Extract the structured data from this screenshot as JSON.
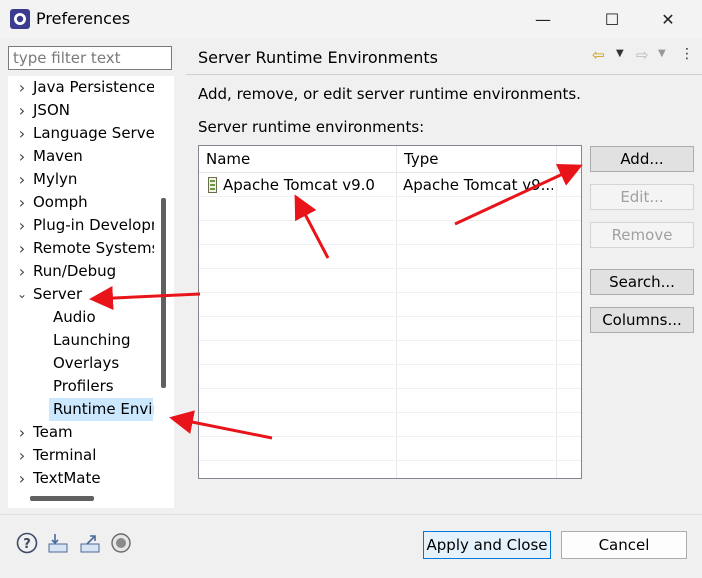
{
  "window": {
    "title": "Preferences",
    "minimize_glyph": "—",
    "maximize_glyph": "☐",
    "close_glyph": "✕"
  },
  "filter": {
    "placeholder": "type filter text",
    "value": ""
  },
  "tree": {
    "items": [
      {
        "label": "Java Persistence",
        "expandable": true
      },
      {
        "label": "JSON",
        "expandable": true
      },
      {
        "label": "Language Servers",
        "expandable": true
      },
      {
        "label": "Maven",
        "expandable": true
      },
      {
        "label": "Mylyn",
        "expandable": true
      },
      {
        "label": "Oomph",
        "expandable": true
      },
      {
        "label": "Plug-in Development",
        "expandable": true
      },
      {
        "label": "Remote Systems",
        "expandable": true
      },
      {
        "label": "Run/Debug",
        "expandable": true
      },
      {
        "label": "Server",
        "expandable": true,
        "expanded": true
      },
      {
        "label": "Audio",
        "child": true
      },
      {
        "label": "Launching",
        "child": true
      },
      {
        "label": "Overlays",
        "child": true
      },
      {
        "label": "Profilers",
        "child": true
      },
      {
        "label": "Runtime Environments",
        "child": true,
        "selected": true
      },
      {
        "label": "Team",
        "expandable": true
      },
      {
        "label": "Terminal",
        "expandable": true
      },
      {
        "label": "TextMate",
        "expandable": true
      }
    ]
  },
  "page": {
    "title": "Server Runtime Environments",
    "description": "Add, remove, or edit server runtime environments.",
    "list_label": "Server runtime environments:"
  },
  "table": {
    "columns": [
      "Name",
      "Type"
    ],
    "rows": [
      {
        "name": "Apache Tomcat v9.0",
        "type": "Apache Tomcat v9..."
      }
    ]
  },
  "buttons": {
    "add": "Add...",
    "edit": "Edit...",
    "remove": "Remove",
    "search": "Search...",
    "columns": "Columns..."
  },
  "footer": {
    "apply_close": "Apply and Close",
    "cancel": "Cancel"
  },
  "colors": {
    "accent": "#0078d7",
    "selection": "#cce8ff",
    "annotation": "#e8141a"
  }
}
